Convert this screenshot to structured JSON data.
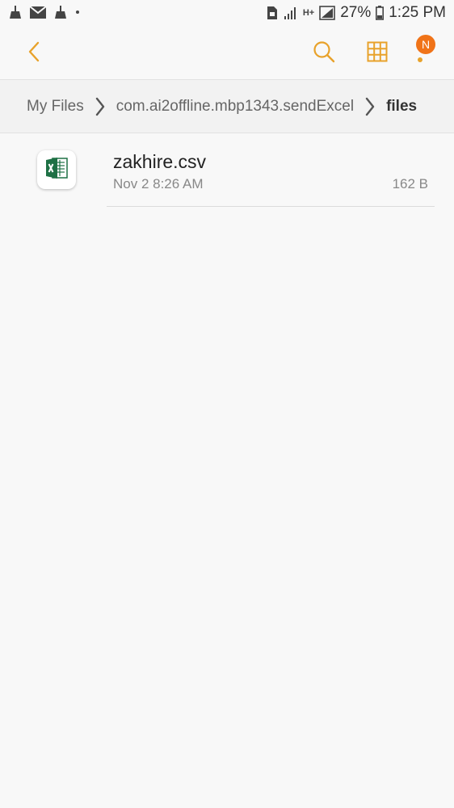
{
  "status_bar": {
    "battery_percent": "27%",
    "time": "1:25 PM",
    "network": "H+",
    "left_icons": [
      "broom-icon",
      "mail-icon",
      "broom-icon",
      "dot-icon"
    ]
  },
  "toolbar": {
    "accent_color": "#e8a22b",
    "notification_badge": "N",
    "badge_color": "#f07318"
  },
  "breadcrumb": {
    "items": [
      "My Files",
      "com.ai2offline.mbp1343.sendExcel",
      "files"
    ]
  },
  "files": [
    {
      "name": "zakhire.csv",
      "date": "Nov 2 8:26 AM",
      "size": "162 B",
      "icon": "excel-icon"
    }
  ]
}
